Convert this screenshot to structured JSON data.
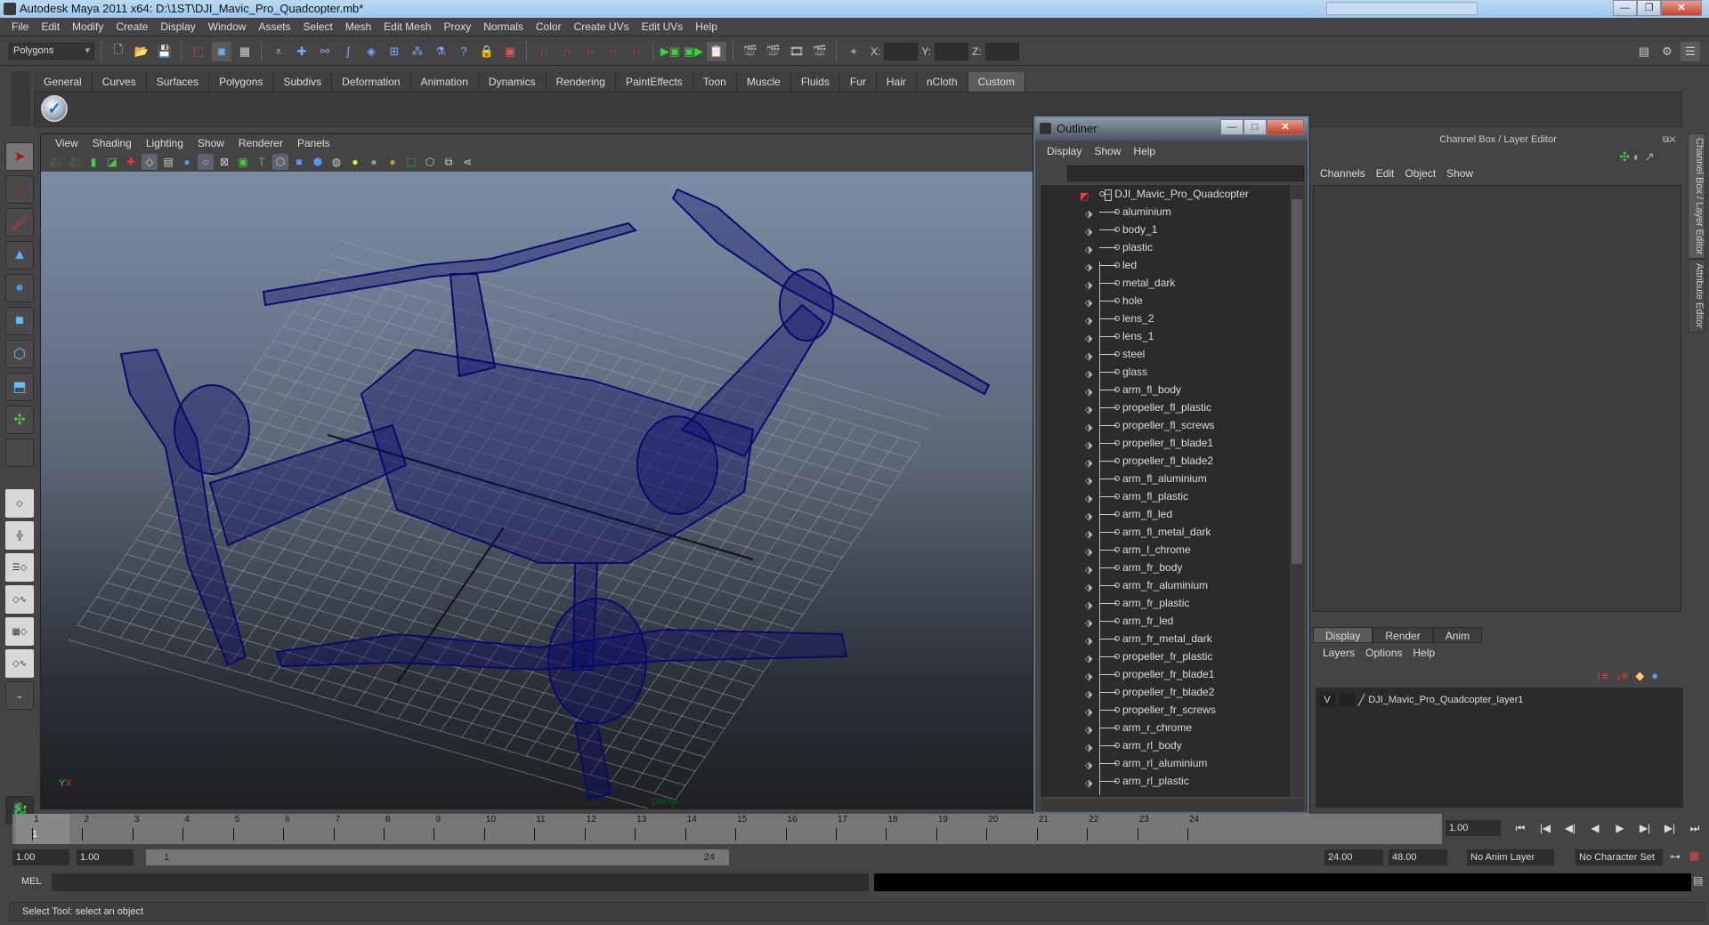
{
  "window": {
    "title": "Autodesk Maya 2011 x64: D:\\1ST\\DJI_Mavic_Pro_Quadcopter.mb*"
  },
  "menubar": [
    "File",
    "Edit",
    "Modify",
    "Create",
    "Display",
    "Window",
    "Assets",
    "Select",
    "Mesh",
    "Edit Mesh",
    "Proxy",
    "Normals",
    "Color",
    "Create UVs",
    "Edit UVs",
    "Help"
  ],
  "toolbar": {
    "mode": "Polygons",
    "x_label": "X:",
    "y_label": "Y:",
    "z_label": "Z:"
  },
  "shelf_tabs": [
    "General",
    "Curves",
    "Surfaces",
    "Polygons",
    "Subdivs",
    "Deformation",
    "Animation",
    "Dynamics",
    "Rendering",
    "PaintEffects",
    "Toon",
    "Muscle",
    "Fluids",
    "Fur",
    "Hair",
    "nCloth",
    "Custom"
  ],
  "shelf_active": "Custom",
  "viewport": {
    "menu": [
      "View",
      "Shading",
      "Lighting",
      "Show",
      "Renderer",
      "Panels"
    ],
    "camera_label": "persp",
    "axis_y": "Y",
    "axis_x": "X",
    "wire_color": "#0a0a6e"
  },
  "outliner": {
    "title": "Outliner",
    "menu": [
      "Display",
      "Show",
      "Help"
    ],
    "root": "DJI_Mavic_Pro_Quadcopter",
    "items": [
      "aluminium",
      "body_1",
      "plastic",
      "led",
      "metal_dark",
      "hole",
      "lens_2",
      "lens_1",
      "steel",
      "glass",
      "arm_fl_body",
      "propeller_fl_plastic",
      "propeller_fl_screws",
      "propeller_fl_blade1",
      "propeller_fl_blade2",
      "arm_fl_aluminium",
      "arm_fl_plastic",
      "arm_fl_led",
      "arm_fl_metal_dark",
      "arm_l_chrome",
      "arm_fr_body",
      "arm_fr_aluminium",
      "arm_fr_plastic",
      "arm_fr_led",
      "arm_fr_metal_dark",
      "propeller_fr_plastic",
      "propeller_fr_blade1",
      "propeller_fr_blade2",
      "propeller_fr_screws",
      "arm_r_chrome",
      "arm_rl_body",
      "arm_rl_aluminium",
      "arm_rl_plastic"
    ]
  },
  "channel_box": {
    "title": "Channel Box / Layer Editor",
    "menu": [
      "Channels",
      "Edit",
      "Object",
      "Show"
    ]
  },
  "layer_editor": {
    "tabs": [
      "Display",
      "Render",
      "Anim"
    ],
    "active_tab": "Display",
    "menu": [
      "Layers",
      "Options",
      "Help"
    ],
    "layer": {
      "visible": "V",
      "name": "DJI_Mavic_Pro_Quadcopter_layer1"
    }
  },
  "side_tabs": [
    "Channel Box / Layer Editor",
    "Attribute Editor"
  ],
  "timeline": {
    "ticks": [
      1,
      2,
      3,
      4,
      5,
      6,
      7,
      8,
      9,
      10,
      11,
      12,
      13,
      14,
      15,
      16,
      17,
      18,
      19,
      20,
      21,
      22,
      23,
      24
    ],
    "current_frame": "1",
    "current_time": "1.00"
  },
  "range": {
    "start": "1.00",
    "playback_start": "1.00",
    "bar_start": "1",
    "bar_end": "24",
    "playback_end": "24.00",
    "end": "48.00",
    "anim_layer": "No Anim Layer",
    "character_set": "No Character Set"
  },
  "mel": {
    "label": "MEL"
  },
  "status": {
    "help_line": "Select Tool: select an object"
  }
}
